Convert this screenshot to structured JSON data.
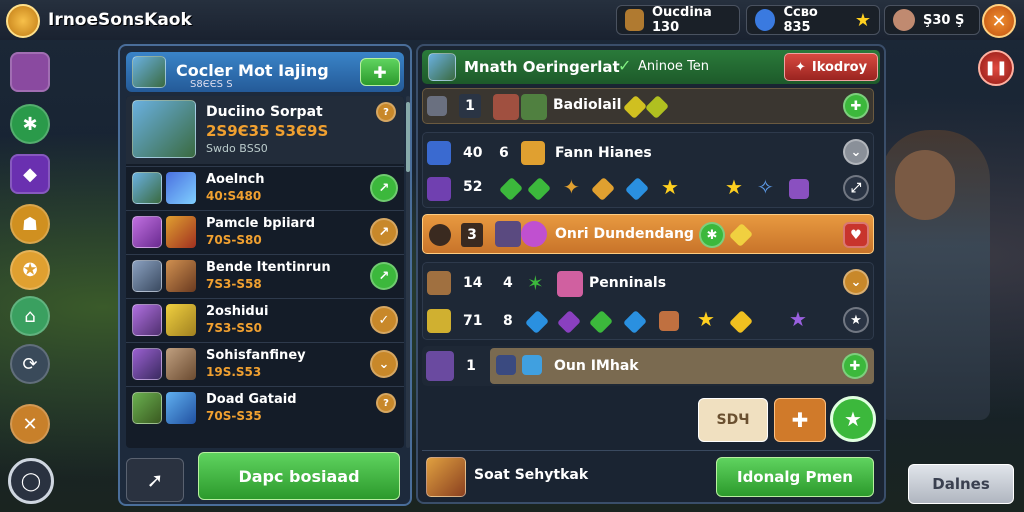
{
  "app": {
    "title": "IrnoeSonsKaok"
  },
  "resources": [
    {
      "label": "Oucdina 130",
      "icon": "chest-icon"
    },
    {
      "label": "Ссво 835",
      "icon": "gem-icon"
    },
    {
      "label": "Ş30 Ş",
      "icon": "star-icon"
    }
  ],
  "left_panel": {
    "title": "Cocler Mot Iajing",
    "subtitle": "Ѕ8ЄЄЅ Ѕ",
    "featured": {
      "name": "Duciino Sorpat",
      "value": "2Ѕ9Є35 Ѕ3Є9Ѕ",
      "sub": "Ѕwdo BЅЅ0"
    },
    "rows": [
      {
        "name": "Aoelnch",
        "value": "40:Ѕ480"
      },
      {
        "name": "Pamcle bpiiard",
        "value": "70Ѕ-Ѕ80"
      },
      {
        "name": "Bende Itentinrun",
        "value": "7Ѕ3-Ѕ58"
      },
      {
        "name": "2oshidui",
        "value": "7Ѕ3-ЅЅ0"
      },
      {
        "name": "Sohisfanfiney",
        "value": "19Ѕ.Ѕ53"
      },
      {
        "name": "Doad Gataid",
        "value": "70Ѕ-Ѕ35"
      }
    ],
    "footer_button": "Dapc bosiaad"
  },
  "right_panel": {
    "title": "Mnath Oeringerlat",
    "status": "Aninoe Ten",
    "red_button": "Ikodroy",
    "slots": [
      {
        "n": "1",
        "label": "Badiolail"
      },
      {
        "a": "40",
        "b": "6",
        "label": "Fann Hianes"
      },
      {
        "a": "52"
      },
      {
        "n": "3",
        "label": "Onri Dundendang"
      },
      {
        "a": "14",
        "b": "4",
        "label": "Penninals"
      },
      {
        "a": "71",
        "b": "8"
      },
      {
        "n": "1",
        "label": "Oun IMhak"
      }
    ],
    "small_btn": "ЅDЧ",
    "footer_label": "Soat Sehytkak",
    "footer_button": "Idonalg Pmen"
  },
  "corner_button": "Dalnes",
  "colors": {
    "accent_green": "#3cb83c",
    "accent_red": "#c8342c",
    "gold": "#f0a030",
    "panel_blue": "#245a98"
  }
}
